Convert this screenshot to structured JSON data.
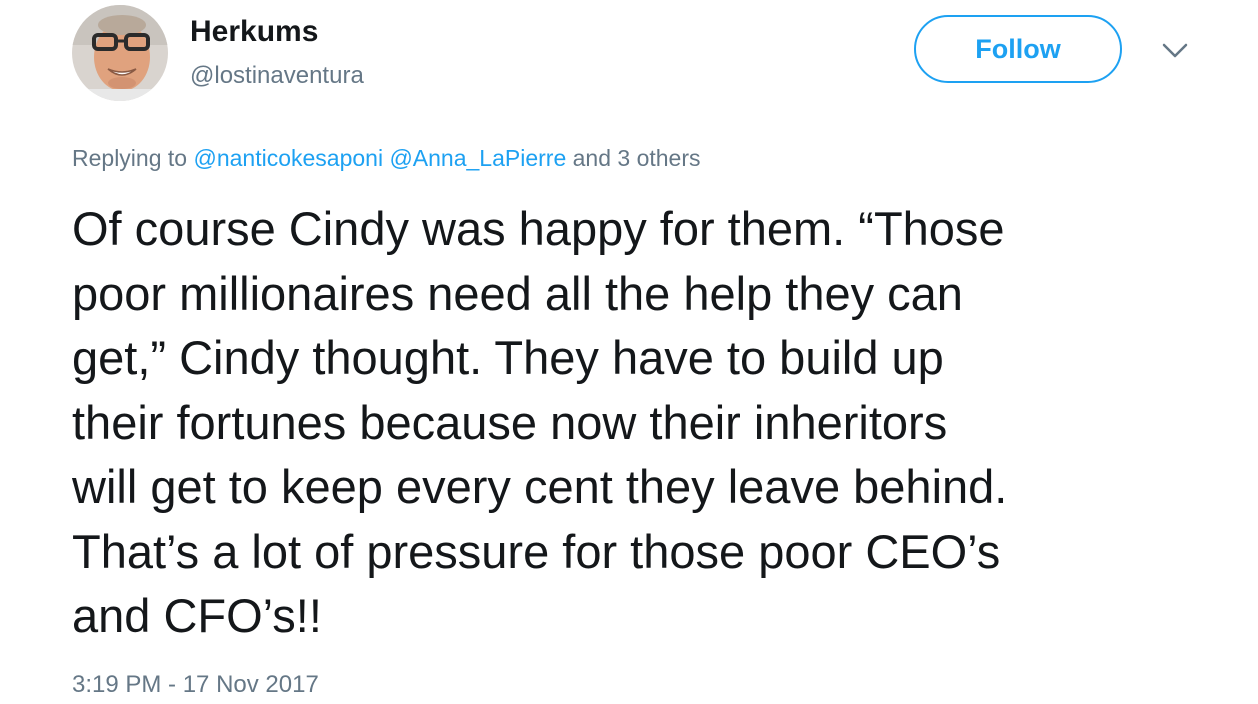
{
  "user": {
    "display_name": "Herkums",
    "handle": "@lostinaventura"
  },
  "actions": {
    "follow_label": "Follow"
  },
  "reply_context": {
    "prefix": "Replying to",
    "mention_1": "@nanticokesaponi",
    "mention_2": "@Anna_LaPierre",
    "suffix": "and 3 others"
  },
  "tweet": {
    "lines": [
      "Of course Cindy was happy for them. “Those",
      "poor millionaires need all the help they can",
      "get,” Cindy thought. They have to build up",
      "their fortunes because now their inheritors",
      "will get to keep every cent they leave behind.",
      "That’s a lot of pressure for those poor CEO’s",
      "and CFO’s!!"
    ],
    "timestamp": "3:19 PM - 17 Nov 2017"
  },
  "icons": {
    "avatar": "profile-photo",
    "menu": "chevron-down-icon"
  },
  "colors": {
    "accent": "#1da1f2",
    "text_primary": "#14171a",
    "text_secondary": "#657786"
  }
}
